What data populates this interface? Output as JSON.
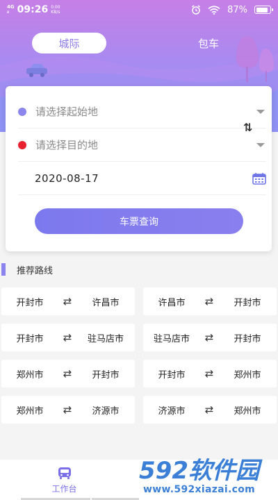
{
  "status_bar": {
    "network": "4G",
    "network_sub": "ᵢₗ",
    "time": "09:26",
    "speed_value": "0.00",
    "speed_unit": "KB/s",
    "battery": "87%",
    "battery_level": 0.87,
    "alarm_icon": "alarm-clock-icon",
    "wifi_icon": "wifi-icon"
  },
  "tabs": [
    {
      "label": "城际",
      "active": true
    },
    {
      "label": "包车",
      "active": false
    }
  ],
  "search": {
    "origin_placeholder": "请选择起始地",
    "destination_placeholder": "请选择目的地",
    "date": "2020-08-17",
    "swap_symbol": "⇅",
    "query_button": "车票查询"
  },
  "recommend": {
    "title": "推荐路线",
    "arrow_symbol": "⇄",
    "routes": [
      {
        "from": "开封市",
        "to": "许昌市"
      },
      {
        "from": "许昌市",
        "to": "开封市"
      },
      {
        "from": "开封市",
        "to": "驻马店市"
      },
      {
        "from": "驻马店市",
        "to": "开封市"
      },
      {
        "from": "郑州市",
        "to": "开封市"
      },
      {
        "from": "开封市",
        "to": "郑州市"
      },
      {
        "from": "郑州市",
        "to": "济源市"
      },
      {
        "from": "济源市",
        "to": "郑州市"
      }
    ]
  },
  "bottom_nav": {
    "items": [
      {
        "label": "工作台",
        "icon": "bus-icon",
        "active": true
      }
    ]
  },
  "watermark": {
    "logo_text": "592软件园",
    "url": "www.592xiazai.com"
  },
  "colors": {
    "accent": "#8b83ee",
    "origin_dot": "#8a86ee",
    "destination_dot": "#e8202f",
    "watermark": "#3b80d6"
  }
}
